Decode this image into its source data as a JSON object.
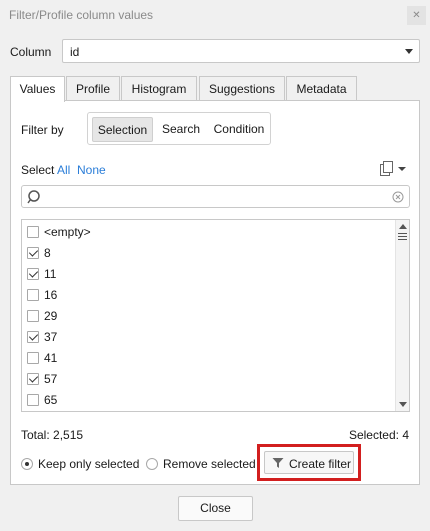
{
  "window": {
    "title": "Filter/Profile column values",
    "close_icon": "close-icon"
  },
  "column": {
    "label": "Column",
    "value": "id"
  },
  "tabs": [
    {
      "label": "Values",
      "active": true
    },
    {
      "label": "Profile",
      "active": false
    },
    {
      "label": "Histogram",
      "active": false
    },
    {
      "label": "Suggestions",
      "active": false
    },
    {
      "label": "Metadata",
      "active": false
    }
  ],
  "filter_by": {
    "label": "Filter by",
    "options": [
      "Selection",
      "Search",
      "Condition"
    ],
    "selected": "Selection"
  },
  "select": {
    "label": "Select",
    "all": "All",
    "none": "None"
  },
  "search": {
    "placeholder": ""
  },
  "values": [
    {
      "label": "<empty>",
      "checked": false
    },
    {
      "label": "8",
      "checked": true
    },
    {
      "label": "11",
      "checked": true
    },
    {
      "label": "16",
      "checked": false
    },
    {
      "label": "29",
      "checked": false
    },
    {
      "label": "37",
      "checked": true
    },
    {
      "label": "41",
      "checked": false
    },
    {
      "label": "57",
      "checked": true
    },
    {
      "label": "65",
      "checked": false
    }
  ],
  "footer": {
    "total": "Total: 2,515",
    "selected": "Selected: 4",
    "keep_only": "Keep only selected",
    "remove": "Remove selected",
    "mode": "keep",
    "create_filter": "Create filter"
  },
  "close_label": "Close",
  "colors": {
    "link": "#2a7dd8",
    "highlight": "#d21f1f"
  }
}
